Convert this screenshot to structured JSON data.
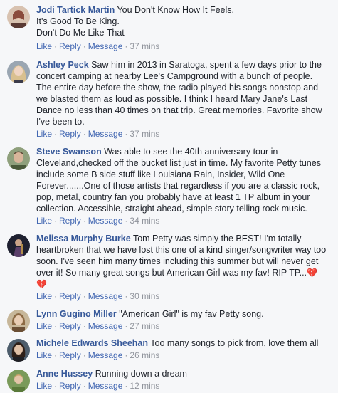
{
  "actions": {
    "like": "Like",
    "reply": "Reply",
    "message": "Message",
    "dot": "·"
  },
  "comments": [
    {
      "author": "Jodi Tartick Martin",
      "lines": [
        "You Don't Know How It Feels.",
        "It's Good To Be King.",
        "Don't Do Me Like That"
      ],
      "time": "37 mins",
      "avatar_color": "#8a4b3c"
    },
    {
      "author": "Ashley Peck",
      "lines": [
        "Saw him in 2013 in Saratoga, spent a few days prior to the",
        "concert camping at nearby Lee's Campground with a bunch of people.",
        "The entire day before the show, the radio played his songs nonstop and",
        "we blasted them as loud as possible. I think I heard Mary Jane's Last",
        "Dance no less than 40 times on that trip. Great memories. Favorite show",
        "I've been to."
      ],
      "time": "37 mins",
      "avatar_color": "#c9b48a"
    },
    {
      "author": "Steve Swanson",
      "lines": [
        "Was able to see the 40th anniversary tour in",
        "Cleveland,checked off the bucket list just in time. My favorite Petty tunes",
        "include some B side stuff like Louisiana Rain, Insider, Wild One",
        "Forever.......One of those artists that regardless if you are a classic rock,",
        "pop, metal, country fan you probably have at least 1 TP album in your",
        "collection. Accessible, straight ahead, simple story telling rock music."
      ],
      "time": "34 mins",
      "avatar_color": "#6d7a5a"
    },
    {
      "author": "Melissa Murphy Burke",
      "lines": [
        "Tom Petty was simply the BEST! I'm totally",
        "heartbroken that we have lost this one of a kind singer/songwriter way too",
        "soon. I've seen him many times including this summer but will never get",
        "over it! So many great songs but American Girl was my fav! RIP TP..."
      ],
      "time": "30 mins",
      "heart": "💔",
      "avatar_color": "#2a2a3a"
    },
    {
      "author": "Lynn Gugino Miller",
      "lines": [
        "\"American Girl\" is my fav Petty song."
      ],
      "time": "27 mins",
      "avatar_color": "#b98c5e"
    },
    {
      "author": "Michele Edwards Sheehan",
      "lines": [
        "Too many songs to pick from, love them all"
      ],
      "time": "26 mins",
      "avatar_color": "#3d2b22"
    },
    {
      "author": "Anne Hussey",
      "lines": [
        "Running down a dream"
      ],
      "time": "12 mins",
      "avatar_color": "#6a8f4c"
    }
  ]
}
